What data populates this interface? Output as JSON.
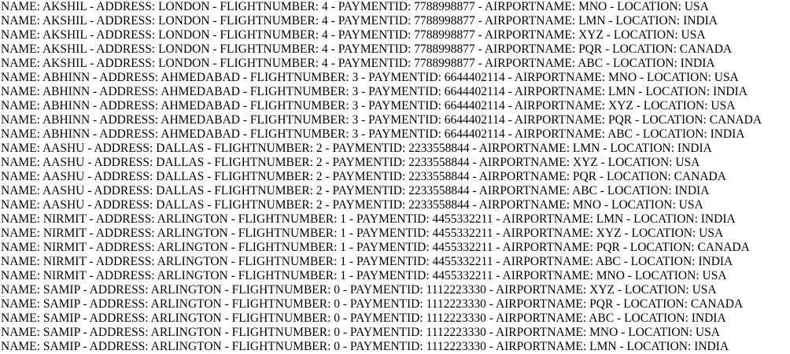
{
  "lines": [
    "NAME: AKSHIL - ADDRESS: LONDON - FLIGHTNUMBER: 4 - PAYMENTID: 7788998877 - AIRPORTNAME: MNO - LOCATION: USA",
    "NAME: AKSHIL - ADDRESS: LONDON - FLIGHTNUMBER: 4 - PAYMENTID: 7788998877 - AIRPORTNAME: LMN - LOCATION: INDIA",
    "NAME: AKSHIL - ADDRESS: LONDON - FLIGHTNUMBER: 4 - PAYMENTID: 7788998877 - AIRPORTNAME: XYZ - LOCATION: USA",
    "NAME: AKSHIL - ADDRESS: LONDON - FLIGHTNUMBER: 4 - PAYMENTID: 7788998877 - AIRPORTNAME: PQR - LOCATION: CANADA",
    "NAME: AKSHIL - ADDRESS: LONDON - FLIGHTNUMBER: 4 - PAYMENTID: 7788998877 - AIRPORTNAME: ABC - LOCATION: INDIA",
    "NAME: ABHINN - ADDRESS: AHMEDABAD - FLIGHTNUMBER: 3 - PAYMENTID: 6644402114 - AIRPORTNAME: MNO - LOCATION: USA",
    "NAME: ABHINN - ADDRESS: AHMEDABAD - FLIGHTNUMBER: 3 - PAYMENTID: 6644402114 - AIRPORTNAME: LMN - LOCATION: INDIA",
    "NAME: ABHINN - ADDRESS: AHMEDABAD - FLIGHTNUMBER: 3 - PAYMENTID: 6644402114 - AIRPORTNAME: XYZ - LOCATION: USA",
    "NAME: ABHINN - ADDRESS: AHMEDABAD - FLIGHTNUMBER: 3 - PAYMENTID: 6644402114 - AIRPORTNAME: PQR - LOCATION: CANADA",
    "NAME: ABHINN - ADDRESS: AHMEDABAD - FLIGHTNUMBER: 3 - PAYMENTID: 6644402114 - AIRPORTNAME: ABC - LOCATION: INDIA",
    "NAME: AASHU - ADDRESS: DALLAS - FLIGHTNUMBER: 2 - PAYMENTID: 2233558844 - AIRPORTNAME: LMN - LOCATION: INDIA",
    "NAME: AASHU - ADDRESS: DALLAS - FLIGHTNUMBER: 2 - PAYMENTID: 2233558844 - AIRPORTNAME: XYZ - LOCATION: USA",
    "NAME: AASHU - ADDRESS: DALLAS - FLIGHTNUMBER: 2 - PAYMENTID: 2233558844 - AIRPORTNAME: PQR - LOCATION: CANADA",
    "NAME: AASHU - ADDRESS: DALLAS - FLIGHTNUMBER: 2 - PAYMENTID: 2233558844 - AIRPORTNAME: ABC - LOCATION: INDIA",
    "NAME: AASHU - ADDRESS: DALLAS - FLIGHTNUMBER: 2 - PAYMENTID: 2233558844 - AIRPORTNAME: MNO - LOCATION: USA",
    "NAME: NIRMIT - ADDRESS: ARLINGTON - FLIGHTNUMBER: 1 - PAYMENTID: 4455332211 - AIRPORTNAME: LMN - LOCATION: INDIA",
    "NAME: NIRMIT - ADDRESS: ARLINGTON - FLIGHTNUMBER: 1 - PAYMENTID: 4455332211 - AIRPORTNAME: XYZ - LOCATION: USA",
    "NAME: NIRMIT - ADDRESS: ARLINGTON - FLIGHTNUMBER: 1 - PAYMENTID: 4455332211 - AIRPORTNAME: PQR - LOCATION: CANADA",
    "NAME: NIRMIT - ADDRESS: ARLINGTON - FLIGHTNUMBER: 1 - PAYMENTID: 4455332211 - AIRPORTNAME: ABC - LOCATION: INDIA",
    "NAME: NIRMIT - ADDRESS: ARLINGTON - FLIGHTNUMBER: 1 - PAYMENTID: 4455332211 - AIRPORTNAME: MNO - LOCATION: USA",
    "NAME: SAMIP - ADDRESS: ARLINGTON - FLIGHTNUMBER: 0 - PAYMENTID: 1112223330 - AIRPORTNAME: XYZ - LOCATION: USA",
    "NAME: SAMIP - ADDRESS: ARLINGTON - FLIGHTNUMBER: 0 - PAYMENTID: 1112223330 - AIRPORTNAME: PQR - LOCATION: CANADA",
    "NAME: SAMIP - ADDRESS: ARLINGTON - FLIGHTNUMBER: 0 - PAYMENTID: 1112223330 - AIRPORTNAME: ABC - LOCATION: INDIA",
    "NAME: SAMIP - ADDRESS: ARLINGTON - FLIGHTNUMBER: 0 - PAYMENTID: 1112223330 - AIRPORTNAME: MNO - LOCATION: USA",
    "NAME: SAMIP - ADDRESS: ARLINGTON - FLIGHTNUMBER: 0 - PAYMENTID: 1112223330 - AIRPORTNAME: LMN - LOCATION: INDIA"
  ]
}
